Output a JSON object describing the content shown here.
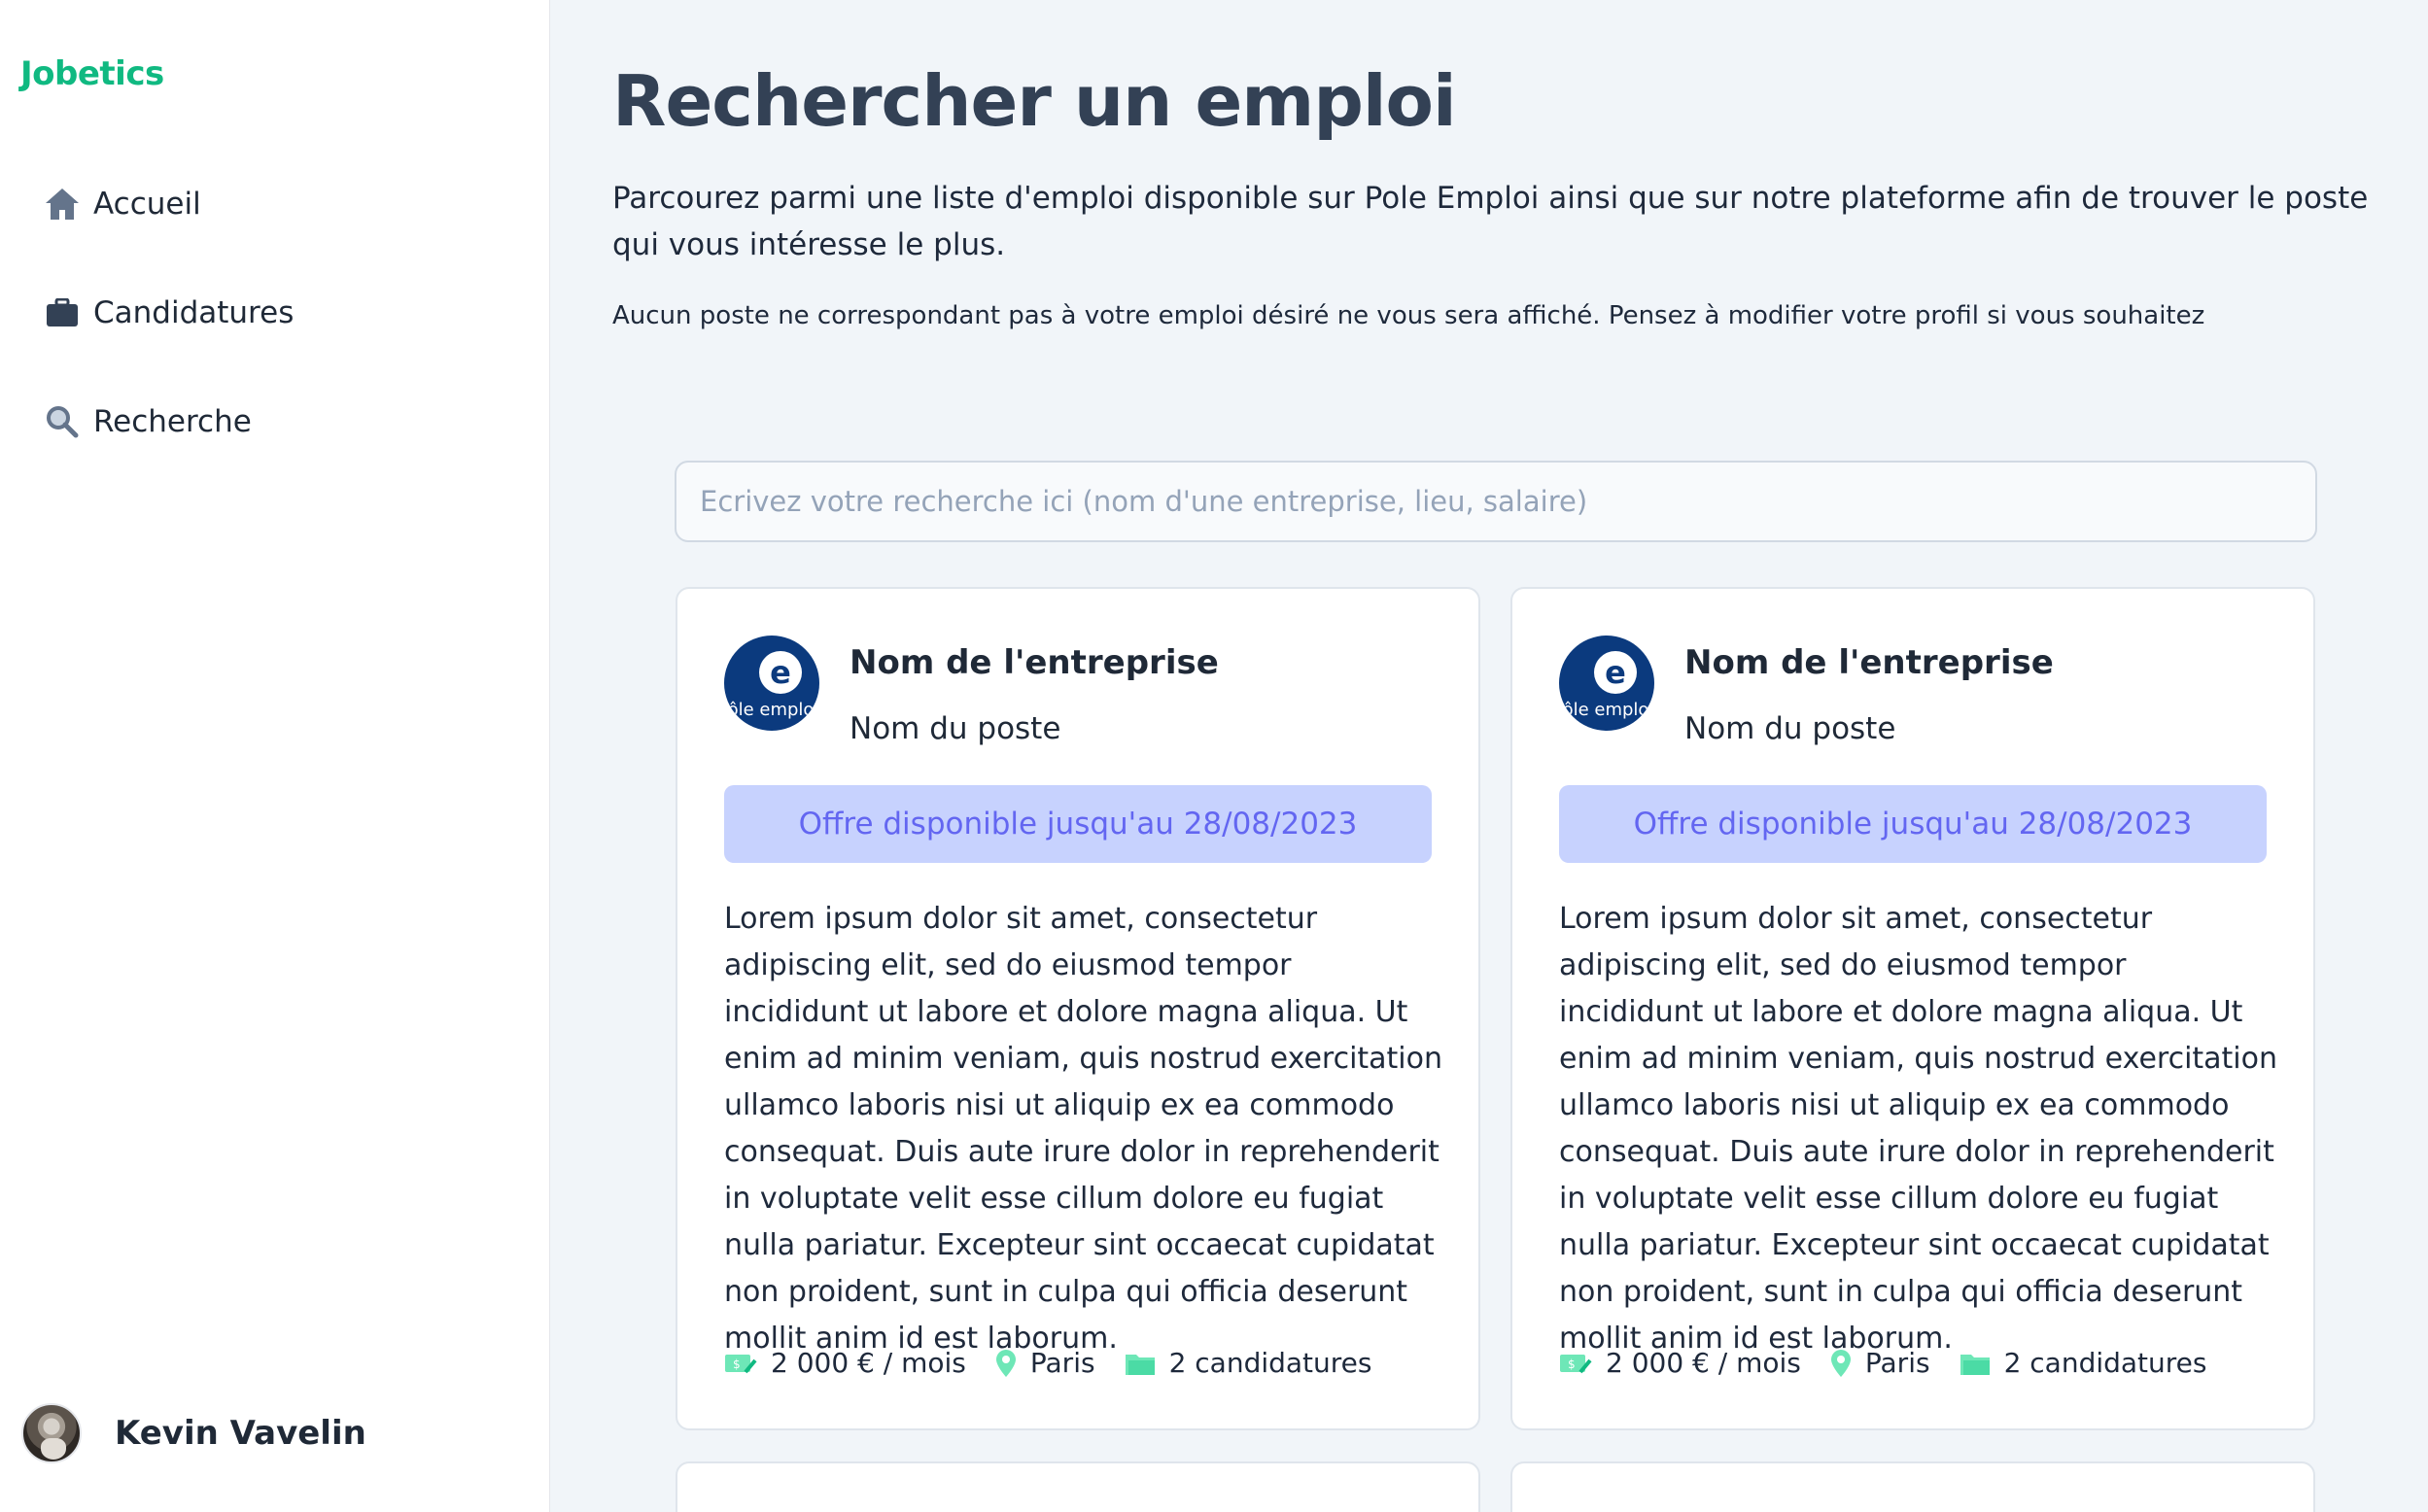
{
  "brand": "Jobetics",
  "nav": {
    "accueil": "Accueil",
    "candidatures": "Candidatures",
    "recherche": "Recherche"
  },
  "user": {
    "name": "Kevin Vavelin"
  },
  "page": {
    "title": "Rechercher un emploi",
    "intro": "Parcourez parmi une liste d'emploi disponible sur Pole Emploi ainsi que sur notre plateforme afin de trouver le poste qui vous intéresse le plus.",
    "note": "Aucun poste ne correspondant pas à votre emploi désiré ne vous sera affiché. Pensez à modifier votre profil si vous souhaitez"
  },
  "search": {
    "placeholder": "Ecrivez votre recherche ici (nom d'une entreprise, lieu, salaire)"
  },
  "cards": [
    {
      "logo_text": "ôle emplo",
      "company": "Nom de l'entreprise",
      "position": "Nom du poste",
      "availability": "Offre disponible jusqu'au 28/08/2023",
      "description": "Lorem ipsum dolor sit amet, consectetur adipiscing elit, sed do eiusmod tempor incididunt ut labore et dolore magna aliqua. Ut enim ad minim veniam, quis nostrud exercitation ullamco laboris nisi ut aliquip ex ea commodo consequat. Duis aute irure dolor in reprehenderit in voluptate velit esse cillum dolore eu fugiat nulla pariatur. Excepteur sint occaecat cupidatat non proident, sunt in culpa qui officia deserunt mollit anim id est laborum.",
      "salary": "2 000 € / mois",
      "location": "Paris",
      "applications": "2 candidatures"
    },
    {
      "logo_text": "ôle emplo",
      "company": "Nom de l'entreprise",
      "position": "Nom du poste",
      "availability": "Offre disponible jusqu'au 28/08/2023",
      "description": "Lorem ipsum dolor sit amet, consectetur adipiscing elit, sed do eiusmod tempor incididunt ut labore et dolore magna aliqua. Ut enim ad minim veniam, quis nostrud exercitation ullamco laboris nisi ut aliquip ex ea commodo consequat. Duis aute irure dolor in reprehenderit in voluptate velit esse cillum dolore eu fugiat nulla pariatur. Excepteur sint occaecat cupidatat non proident, sunt in culpa qui officia deserunt mollit anim id est laborum.",
      "salary": "2 000 € / mois",
      "location": "Paris",
      "applications": "2 candidatures"
    }
  ],
  "icons": {
    "home": "home-icon",
    "briefcase": "briefcase-icon",
    "search": "search-icon",
    "salary": "money-icon",
    "location": "map-pin-icon",
    "applications": "folder-icon"
  },
  "colors": {
    "brand": "#10b981",
    "accent_bg": "#c7d2fe",
    "accent_text": "#6366f1",
    "meta_icon": "#6ee7b7",
    "logo_bg": "#0b3a7e"
  }
}
